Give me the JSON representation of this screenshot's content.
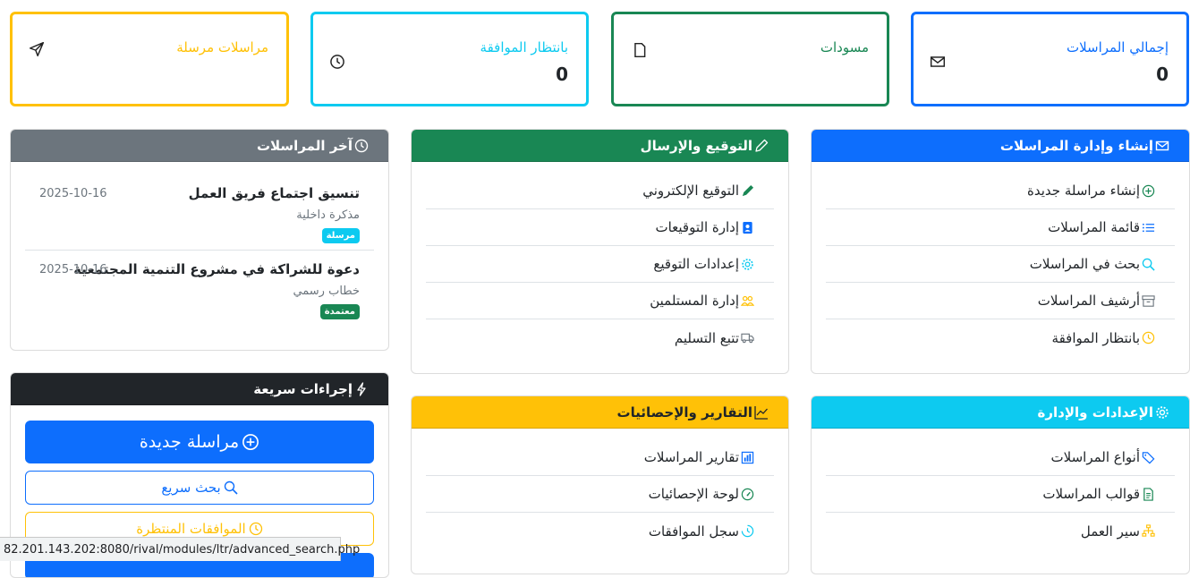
{
  "stats": [
    {
      "label": "إجمالي المراسلات",
      "value": "0",
      "color": "#0d6efd",
      "icon": "envelope-icon"
    },
    {
      "label": "مسودات",
      "value": "",
      "color": "#198754",
      "icon": "file-icon"
    },
    {
      "label": "بانتظار الموافقة",
      "value": "0",
      "color": "#0dcaf0",
      "icon": "clock-icon"
    },
    {
      "label": "مراسلات مرسلة",
      "value": "",
      "color": "#ffc107",
      "icon": "send-icon"
    }
  ],
  "manage": {
    "title": "إنشاء وإدارة المراسلات",
    "items": [
      "إنشاء مراسلة جديدة",
      "قائمة المراسلات",
      "بحث في المراسلات",
      "أرشيف المراسلات",
      "بانتظار الموافقة"
    ]
  },
  "sign": {
    "title": "التوقيع والإرسال",
    "items": [
      "التوقيع الإلكتروني",
      "إدارة التوقيعات",
      "إعدادات التوقيع",
      "إدارة المستلمين",
      "تتبع التسليم"
    ]
  },
  "recent": {
    "title": "آخر المراسلات",
    "items": [
      {
        "title": "تنسيق اجتماع فريق العمل",
        "date": "2025-10-16",
        "type": "مذكرة داخلية",
        "badge": "مرسلة",
        "badge_color": "#0dcaf0"
      },
      {
        "title": "دعوة للشراكة في مشروع التنمية المجتمعية",
        "date": "2025-10-16",
        "type": "خطاب رسمي",
        "badge": "معتمدة",
        "badge_color": "#198754"
      }
    ]
  },
  "settings": {
    "title": "الإعدادات والإدارة",
    "items": [
      "أنواع المراسلات",
      "قوالب المراسلات",
      "سير العمل"
    ]
  },
  "reports": {
    "title": "التقارير والإحصائيات",
    "items": [
      "تقارير المراسلات",
      "لوحة الإحصائيات",
      "سجل الموافقات"
    ]
  },
  "quick": {
    "title": "إجراءات سريعة",
    "new_label": "مراسلة جديدة",
    "search_label": "بحث سريع",
    "pending_label": "الموافقات المنتظرة"
  },
  "status_url": "82.201.143.202:8080/rival/modules/ltr/advanced_search.php"
}
